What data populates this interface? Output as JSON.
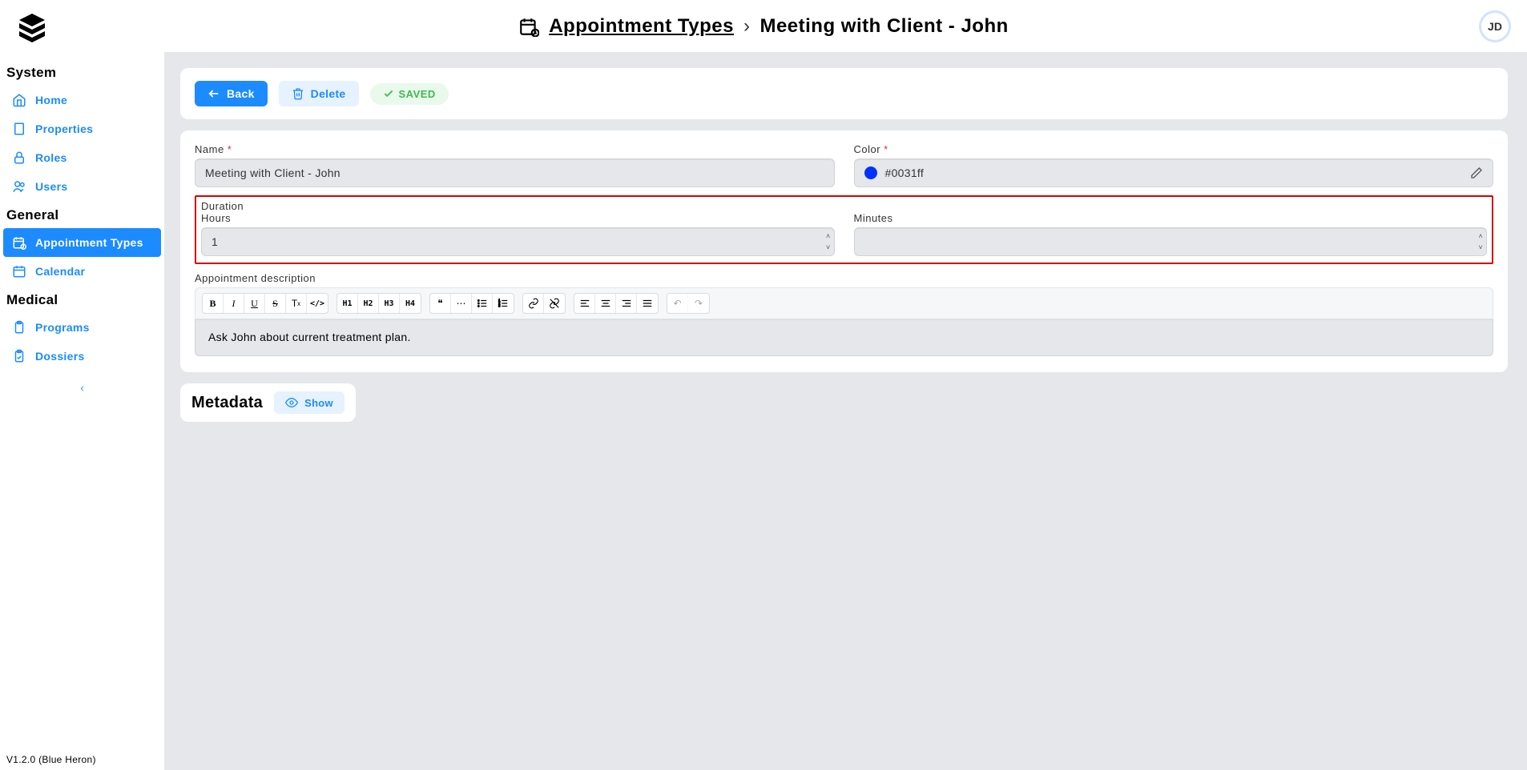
{
  "avatar": {
    "initials": "JD"
  },
  "breadcrumb": {
    "parent": "Appointment Types",
    "current": "Meeting with Client - John",
    "separator": "›"
  },
  "sidebar": {
    "groups": [
      {
        "title": "System",
        "items": [
          {
            "label": "Home"
          },
          {
            "label": "Properties"
          },
          {
            "label": "Roles"
          },
          {
            "label": "Users"
          }
        ]
      },
      {
        "title": "General",
        "items": [
          {
            "label": "Appointment Types"
          },
          {
            "label": "Calendar"
          }
        ]
      },
      {
        "title": "Medical",
        "items": [
          {
            "label": "Programs"
          },
          {
            "label": "Dossiers"
          }
        ]
      }
    ],
    "collapse": "‹"
  },
  "actions": {
    "back": "Back",
    "delete": "Delete",
    "saved": "SAVED"
  },
  "form": {
    "name_label": "Name",
    "name_value": "Meeting with Client - John",
    "color_label": "Color",
    "color_value": "#0031ff",
    "duration_label": "Duration",
    "hours_label": "Hours",
    "hours_value": "1",
    "minutes_label": "Minutes",
    "minutes_value": "",
    "description_label": "Appointment description",
    "description_value": "Ask John about current treatment plan."
  },
  "toolbar": {
    "b": "B",
    "i": "I",
    "u": "U",
    "s": "S",
    "tx": "T",
    "code": "</>",
    "h1": "H1",
    "h2": "H2",
    "h3": "H3",
    "h4": "H4",
    "quote": "❝",
    "hr": "⋯",
    "ul": "≔",
    "ol": "⒈",
    "link": "🔗",
    "unlink": "⛓",
    "al": "≡",
    "ac": "≡",
    "ar": "≡",
    "aj": "≡",
    "undo": "↶",
    "redo": "↷"
  },
  "metadata": {
    "title": "Metadata",
    "show": "Show"
  },
  "version": "V1.2.0 (Blue Heron)"
}
